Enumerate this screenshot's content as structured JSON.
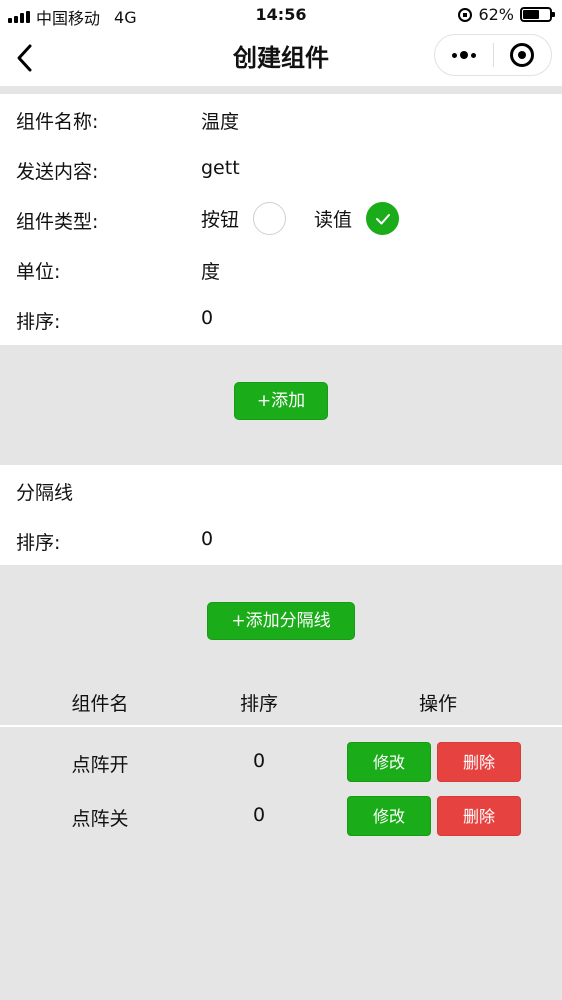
{
  "status_bar": {
    "carrier": "中国移动",
    "network": "4G",
    "time": "14:56",
    "battery": "62%",
    "battery_level": 0.62
  },
  "nav": {
    "title": "创建组件"
  },
  "component_form": {
    "name_label": "组件名称:",
    "name_value": "温度",
    "content_label": "发送内容:",
    "content_value": "gett",
    "type_label": "组件类型:",
    "type_options": [
      {
        "label": "按钮",
        "checked": false
      },
      {
        "label": "读值",
        "checked": true
      }
    ],
    "unit_label": "单位:",
    "unit_value": "度",
    "order_label": "排序:",
    "order_value": "0"
  },
  "add_button": "+添加",
  "divider_form": {
    "title": "分隔线",
    "order_label": "排序:",
    "order_value": "0"
  },
  "add_divider_button": "+添加分隔线",
  "table": {
    "headers": [
      "组件名",
      "排序",
      "操作"
    ],
    "rows": [
      {
        "name": "点阵开",
        "order": "0",
        "edit": "修改",
        "delete": "删除"
      },
      {
        "name": "点阵关",
        "order": "0",
        "edit": "修改",
        "delete": "删除"
      }
    ]
  },
  "colors": {
    "primary": "#1aad19",
    "danger": "#e64340",
    "background": "#e5e5e5"
  }
}
